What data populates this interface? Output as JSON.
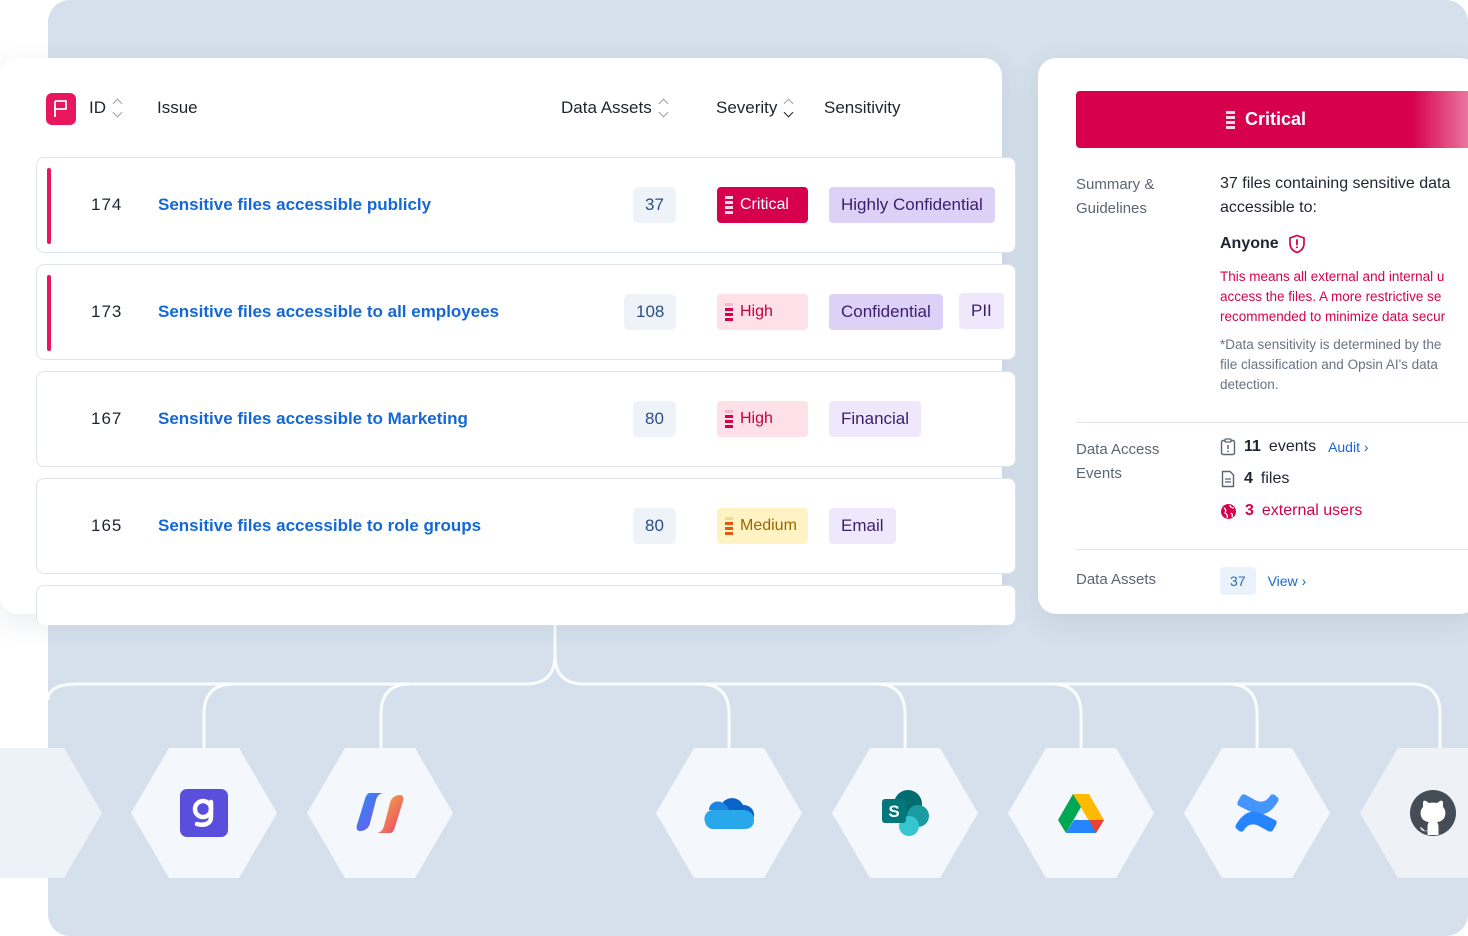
{
  "table": {
    "headers": {
      "id": "ID",
      "issue": "Issue",
      "data_assets": "Data Assets",
      "severity": "Severity",
      "sensitivity": "Sensitivity"
    },
    "rows": [
      {
        "id": "174",
        "issue": "Sensitive files accessible publicly",
        "assets": "37",
        "severity": "Critical",
        "sensitivity": [
          "Highly Confidential"
        ]
      },
      {
        "id": "173",
        "issue": "Sensitive files accessible to all employees",
        "assets": "108",
        "severity": "High",
        "sensitivity": [
          "Confidential",
          "PII"
        ]
      },
      {
        "id": "167",
        "issue": "Sensitive files accessible to Marketing",
        "assets": "80",
        "severity": "High",
        "sensitivity": [
          "Financial"
        ]
      },
      {
        "id": "165",
        "issue": "Sensitive files accessible to role groups",
        "assets": "80",
        "severity": "Medium",
        "sensitivity": [
          "Email"
        ]
      }
    ]
  },
  "detail": {
    "severity_banner": "Critical",
    "summary_label": "Summary & Guidelines",
    "summary_text_1": "37 files containing sensitive data",
    "summary_text_2": "accessible to:",
    "audience": "Anyone",
    "warning_lines": [
      "This means all external and internal u",
      "access the files. A more restrictive se",
      "recommended to minimize data secur"
    ],
    "note_lines": [
      "*Data sensitivity is determined by the",
      "file classification and Opsin AI's data",
      "detection."
    ],
    "access_label": "Data Access Events",
    "events_count": "11",
    "events_word": "events",
    "audit_link": "Audit",
    "files_count": "4",
    "files_word": "files",
    "external_count": "3",
    "external_word": "external users",
    "assets_label": "Data Assets",
    "assets_count": "37",
    "view_link": "View"
  },
  "integrations": [
    {
      "name": "partial-left-icon"
    },
    {
      "name": "gong-icon"
    },
    {
      "name": "microsoft-copilot-icon"
    },
    {
      "name": "onedrive-icon"
    },
    {
      "name": "sharepoint-icon"
    },
    {
      "name": "google-drive-icon"
    },
    {
      "name": "confluence-icon"
    },
    {
      "name": "github-icon"
    }
  ],
  "colors": {
    "accent": "#e8175d",
    "critical": "#d6004c",
    "link": "#1468d6",
    "background_panel": "#d5e0ec"
  }
}
